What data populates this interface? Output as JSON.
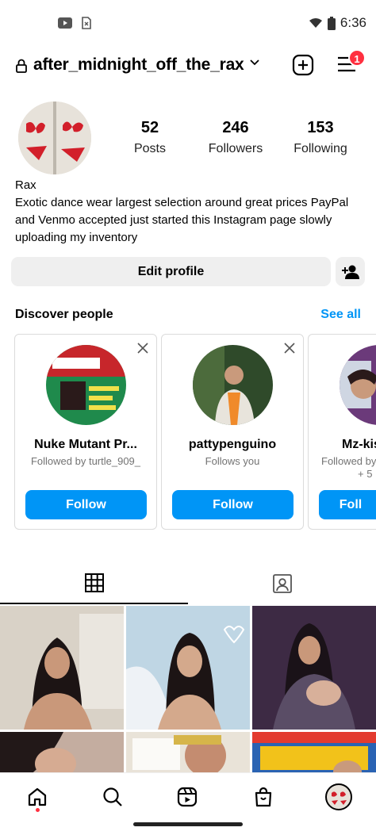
{
  "status_bar": {
    "time": "6:36"
  },
  "header": {
    "username": "after_midnight_off_the_rax",
    "notifications": "1"
  },
  "profile": {
    "stats": [
      {
        "value": "52",
        "label": "Posts"
      },
      {
        "value": "246",
        "label": "Followers"
      },
      {
        "value": "153",
        "label": "Following"
      }
    ],
    "name": "Rax",
    "bio": "Exotic dance wear largest selection around great prices PayPal and Venmo accepted just started this Instagram page slowly uploading my inventory"
  },
  "actions": {
    "edit_profile": "Edit profile"
  },
  "discover": {
    "title": "Discover people",
    "see_all": "See all",
    "cards": [
      {
        "name": "Nuke Mutant Pr...",
        "sub": "Followed by turtle_909_",
        "button": "Follow"
      },
      {
        "name": "pattypenguino",
        "sub": "Follows you",
        "button": "Follow"
      },
      {
        "name": "Mz-kis",
        "sub": "Followed by",
        "sub2": "+ 5",
        "button": "Foll"
      }
    ]
  },
  "icons": {
    "status": [
      "youtube-icon",
      "sim-icon",
      "wifi-icon",
      "battery-icon"
    ],
    "tabs": [
      "grid-icon",
      "tagged-icon"
    ],
    "nav": [
      "home-icon",
      "search-icon",
      "reels-icon",
      "shop-icon",
      "profile-avatar"
    ]
  },
  "colors": {
    "accent": "#0095f6",
    "badge": "#ff3040"
  }
}
